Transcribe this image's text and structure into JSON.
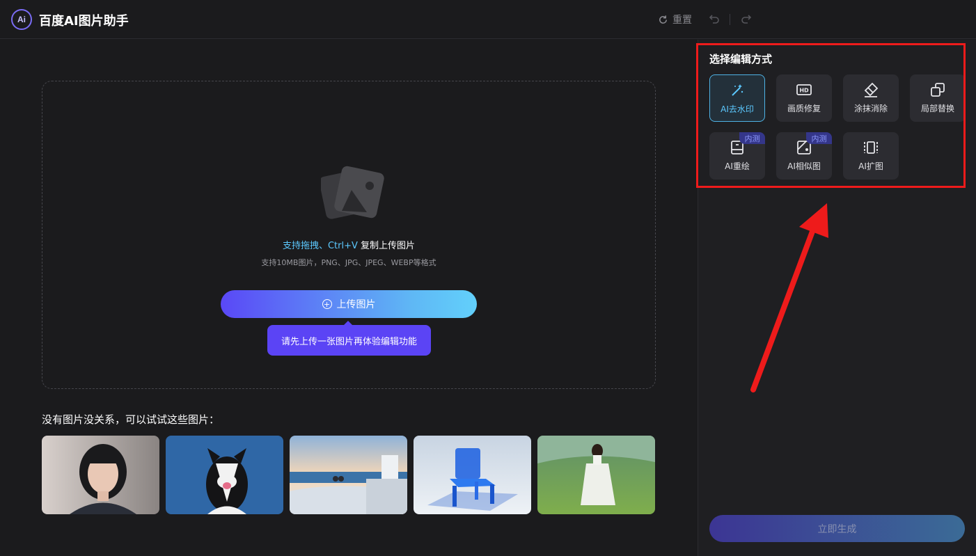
{
  "header": {
    "logo_text": "Ai",
    "title": "百度AI图片助手",
    "reset_label": "重置",
    "undo_icon": "undo-icon",
    "redo_icon": "redo-icon"
  },
  "upload": {
    "hint_part1": "支持拖拽、Ctrl+V",
    "hint_part2": " 复制上传图片",
    "formats": "支持10MB图片，PNG、JPG、JPEG、WEBP等格式",
    "button_label": "上传图片",
    "tooltip": "请先上传一张图片再体验编辑功能"
  },
  "samples": {
    "title": "没有图片没关系，可以试试这些图片：",
    "items": [
      "portrait-woman",
      "border-collie-dog",
      "seaside-terrace",
      "blue-glass-chair",
      "girl-in-meadow"
    ]
  },
  "panel": {
    "title": "选择编辑方式",
    "tools": [
      {
        "label": "AI去水印",
        "icon": "magic-wand-icon",
        "active": true
      },
      {
        "label": "画质修复",
        "icon": "hd-icon"
      },
      {
        "label": "涂抹消除",
        "icon": "eraser-icon"
      },
      {
        "label": "局部替换",
        "icon": "replace-icon"
      },
      {
        "label": "AI重绘",
        "icon": "redraw-icon",
        "badge": "内测"
      },
      {
        "label": "AI相似图",
        "icon": "similar-image-icon",
        "badge": "内测"
      },
      {
        "label": "AI扩图",
        "icon": "expand-icon"
      }
    ],
    "generate_label": "立即生成"
  },
  "colors": {
    "accent_blue": "#5cc9ff",
    "accent_purple": "#5b44f5",
    "annotation_red": "#ee1b1b"
  }
}
